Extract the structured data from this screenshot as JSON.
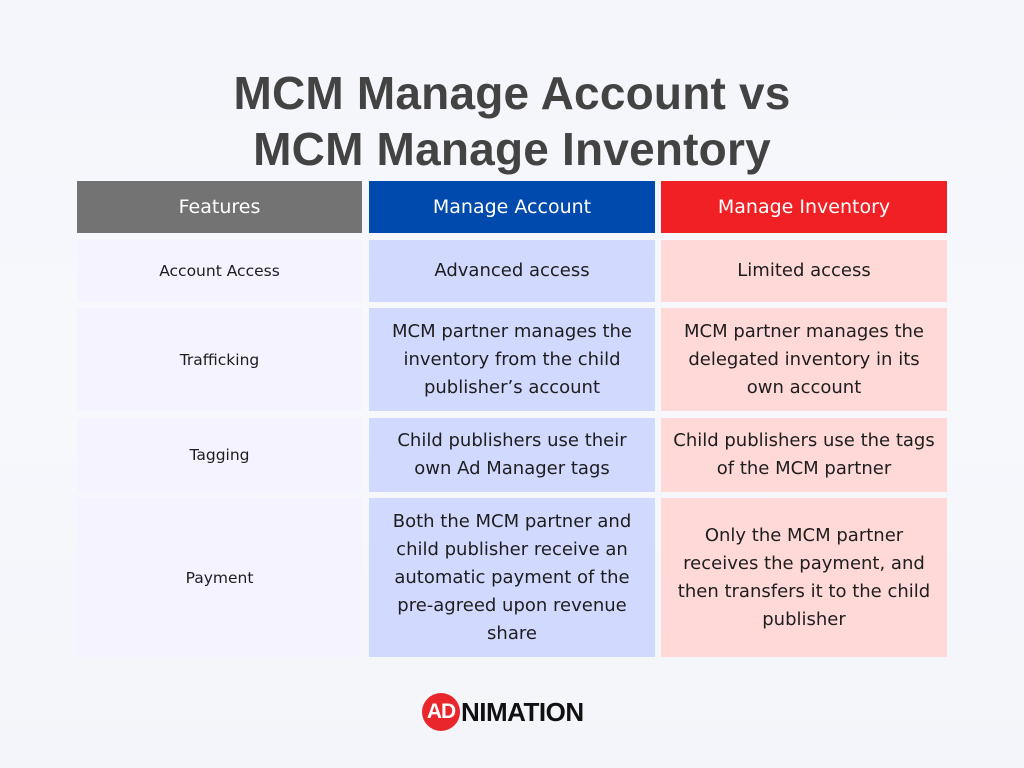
{
  "title": {
    "line1": "MCM Manage Account vs",
    "line2": "MCM Manage Inventory"
  },
  "colors": {
    "features_header": "#737373",
    "account_header": "#004aad",
    "inventory_header": "#f02024",
    "features_cell": "#f5f3ff",
    "account_cell": "#d2d9ff",
    "inventory_cell": "#ffd8d8"
  },
  "table": {
    "headers": [
      "Features",
      "Manage Account",
      "Manage Inventory"
    ],
    "rows": [
      {
        "feature": "Account Access",
        "account": "Advanced access",
        "inventory": "Limited access"
      },
      {
        "feature": "Trafficking",
        "account": "MCM partner manages the inventory from the child publisher’s account",
        "inventory": "MCM partner manages the delegated inventory in its own account"
      },
      {
        "feature": "Tagging",
        "account": "Child publishers use their own Ad Manager tags",
        "inventory": "Child publishers use the tags of the MCM partner"
      },
      {
        "feature": "Payment",
        "account": "Both the MCM partner and child publisher receive an automatic payment of the pre-agreed upon revenue share",
        "inventory": "Only the MCM partner receives the payment, and then transfers it to the child publisher"
      }
    ]
  },
  "logo": {
    "badge": "AD",
    "text": "NIMATION",
    "icon": "adnimation-logo-icon"
  }
}
